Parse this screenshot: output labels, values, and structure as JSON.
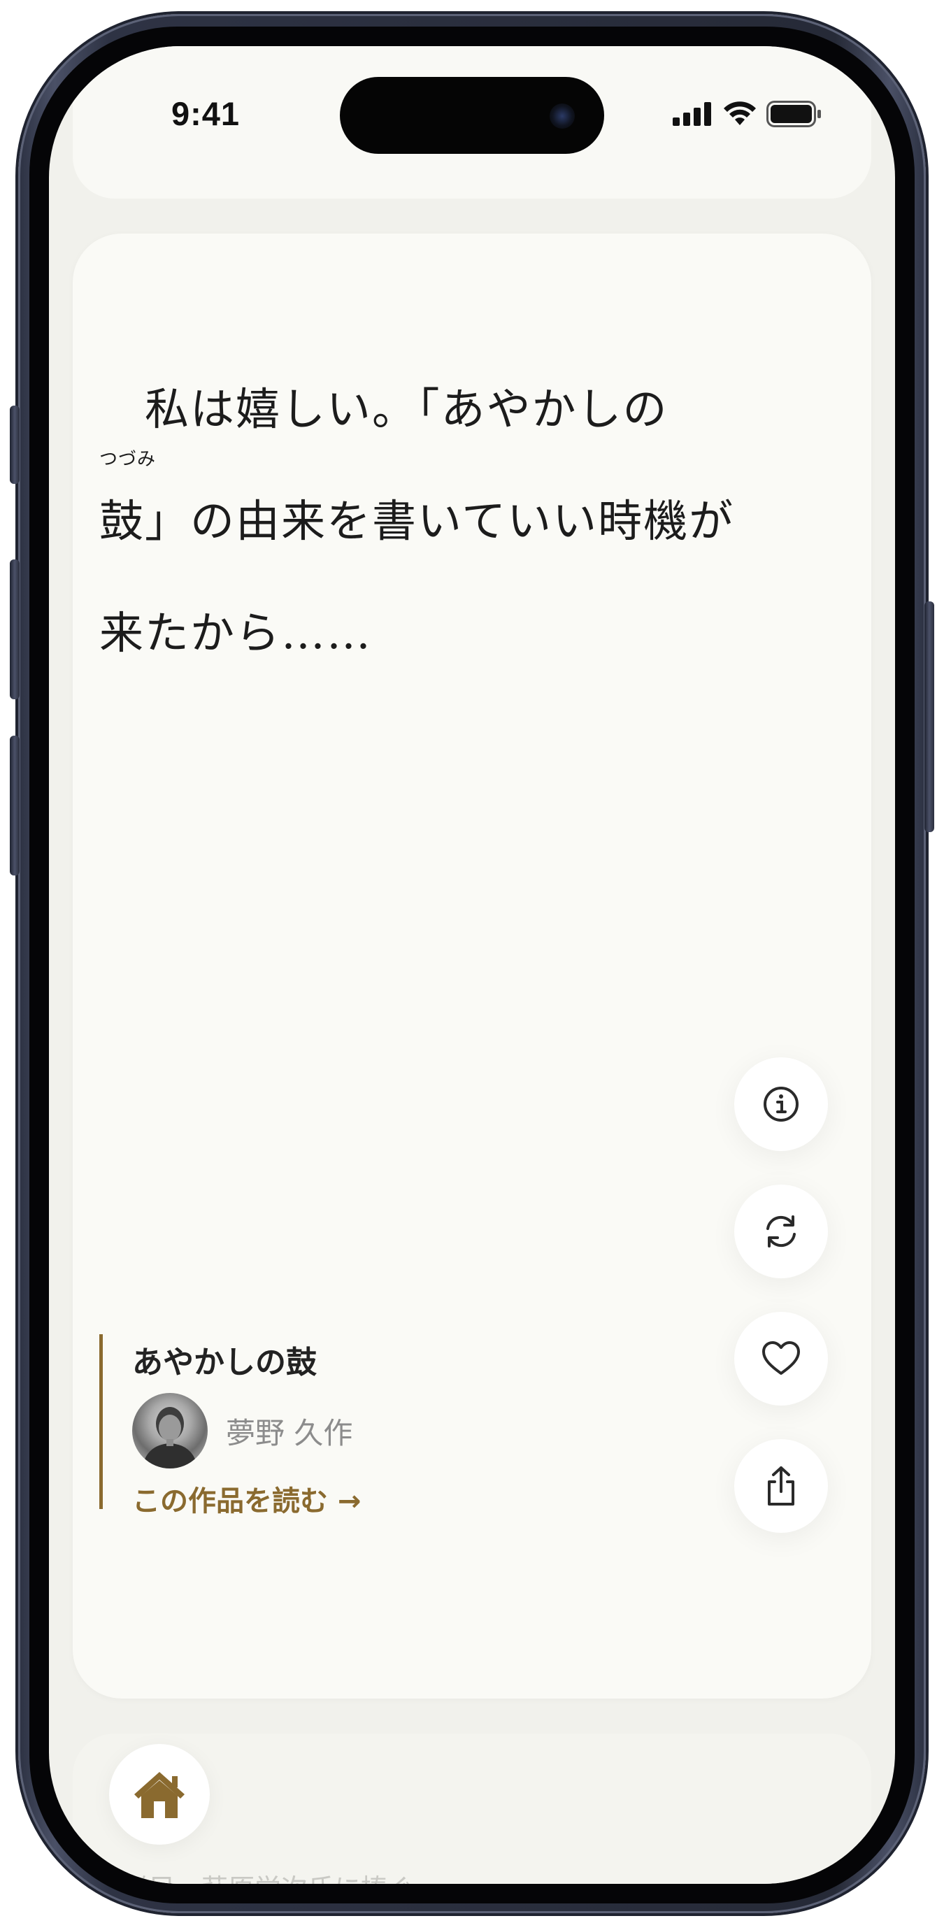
{
  "status_bar": {
    "time": "9:41"
  },
  "quote": {
    "line1": "　私は嬉しい。「あやかしの",
    "line2_ruby_base": "鼓",
    "line2_ruby_reading": "つづみ",
    "line2_rest": "」の由来を書いていい時機が",
    "line3": "来たから……"
  },
  "work": {
    "title": "あやかしの鼓",
    "author": "夢野 久作",
    "read_link": "この作品を読む →"
  },
  "actions": [
    {
      "name": "info",
      "icon": "info-icon"
    },
    {
      "name": "refresh",
      "icon": "refresh-icon"
    },
    {
      "name": "favorite",
      "icon": "heart-icon"
    },
    {
      "name": "share",
      "icon": "share-icon"
    }
  ],
  "bottom": {
    "home_icon": "home-icon",
    "dedication": "従兄　萩原栄次氏に捧ぐ"
  },
  "colors": {
    "accent": "#8a6a2f",
    "background": "#fafaf6",
    "text": "#1c1c1c"
  }
}
